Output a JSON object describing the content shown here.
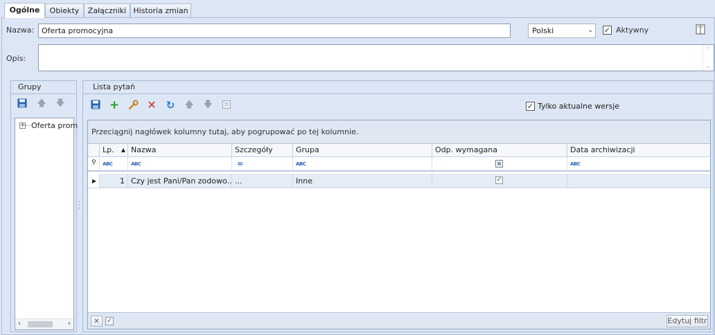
{
  "tabs": [
    {
      "label": "Ogólne"
    },
    {
      "label": "Obiekty"
    },
    {
      "label": "Załączniki"
    },
    {
      "label": "Historia zmian"
    }
  ],
  "form": {
    "name_label": "Nazwa:",
    "name_value": "Oferta promocyjna",
    "language": "Polski",
    "active_label": "Aktywny",
    "active_checked": true,
    "desc_label": "Opis:"
  },
  "groups": {
    "title": "Grupy",
    "tree_item": "Oferta prom"
  },
  "questions": {
    "title": "Lista pytań",
    "only_current_label": "Tylko aktualne wersje",
    "only_current_checked": true,
    "groupbar_text": "Przeciągnij nagłówek kolumny tutaj, aby pogrupować po tej kolumnie.",
    "columns": [
      "Lp.",
      "Nazwa",
      "Szczegóły",
      "Grupa",
      "Odp. wymagana",
      "Data archiwizacji"
    ],
    "rows": [
      {
        "lp": "1",
        "nazwa": "Czy jest Pani/Pan zodowo...",
        "szczegoly": "...",
        "grupa": "Inne",
        "wymagana": true,
        "data": ""
      }
    ],
    "edit_filter": "Edytuj filtr"
  }
}
